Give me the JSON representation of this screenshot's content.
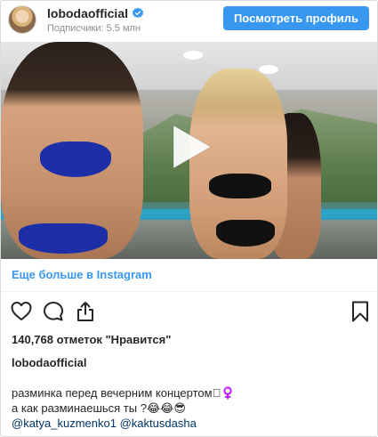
{
  "header": {
    "username": "lobodaofficial",
    "followers": "Подписчики: 5.5 млн",
    "profile_button": "Посмотреть профиль"
  },
  "post": {
    "more_link": "Еще больше в Instagram",
    "likes": "140,768 отметок \"Нравится\"",
    "author": "lobodaofficial",
    "caption_line1": "разминка перед вечерним концертом🏻‍♀️",
    "caption_line2": "а как разминаешься ты ?😂😂😎",
    "mention1": "@katya_kuzmenko1",
    "mention2": "@kaktusdasha"
  },
  "icons": {
    "verified": "verified-badge-icon",
    "play": "play-icon",
    "like": "heart-icon",
    "comment": "comment-icon",
    "share": "share-icon",
    "save": "bookmark-icon"
  },
  "colors": {
    "accent": "#3897f0",
    "text": "#262626",
    "muted": "#8e8e8e",
    "mention": "#003569"
  }
}
